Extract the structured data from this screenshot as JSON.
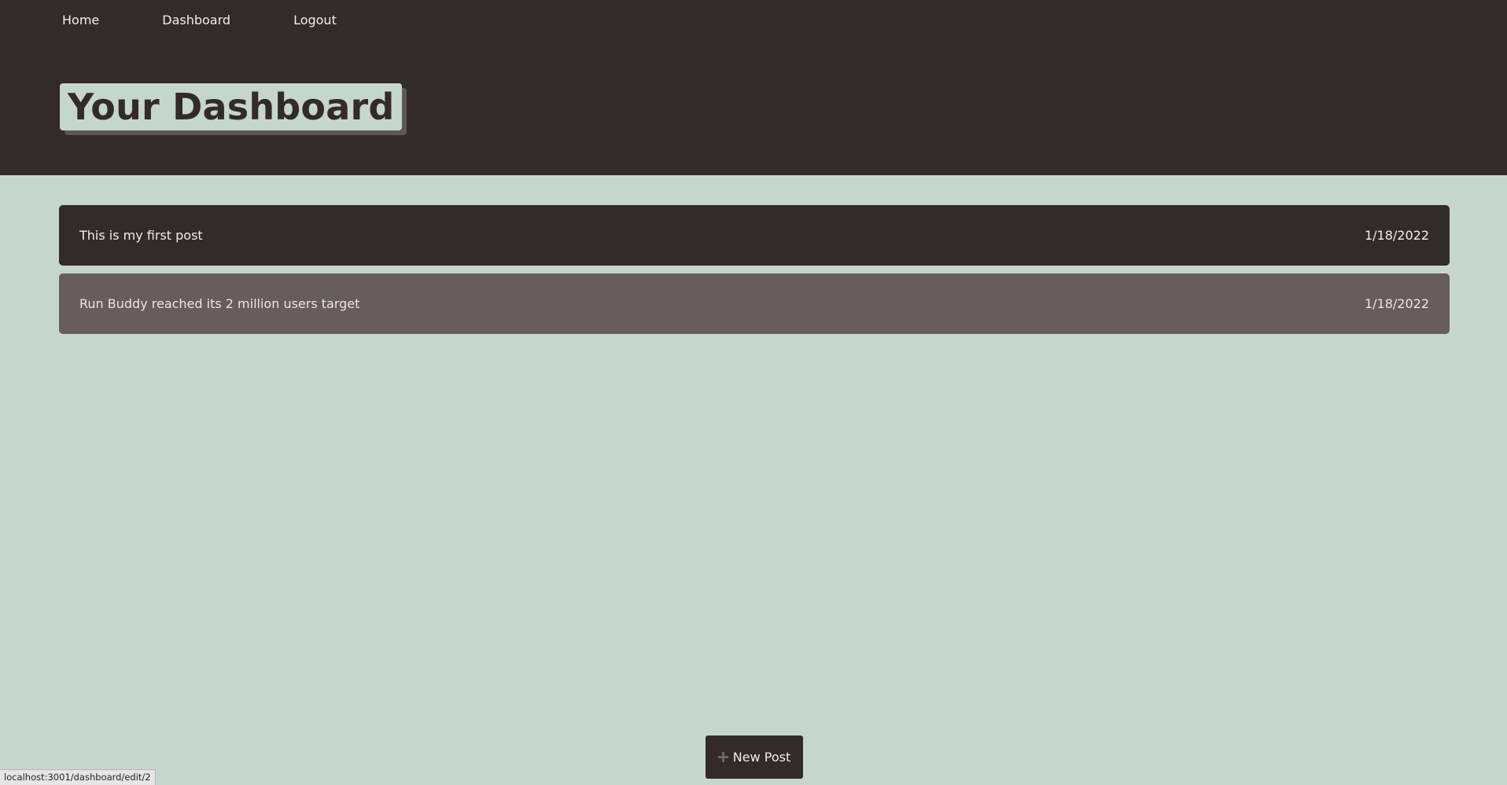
{
  "nav": {
    "items": [
      {
        "label": "Home"
      },
      {
        "label": "Dashboard"
      },
      {
        "label": "Logout"
      }
    ]
  },
  "header": {
    "title": "Your Dashboard"
  },
  "posts": [
    {
      "title": "This is my first post",
      "date": "1/18/2022"
    },
    {
      "title": "Run Buddy reached its 2 million users target",
      "date": "1/18/2022"
    }
  ],
  "actions": {
    "new_post_label": "New Post"
  },
  "status_bar": {
    "url": "localhost:3001/dashboard/edit/2"
  },
  "colors": {
    "header_bg": "#332a2a",
    "page_bg": "#c5d7cc",
    "post_dark": "#332a2a",
    "post_hover": "#675d5c"
  },
  "icons": {
    "new_post": "plus-icon"
  }
}
